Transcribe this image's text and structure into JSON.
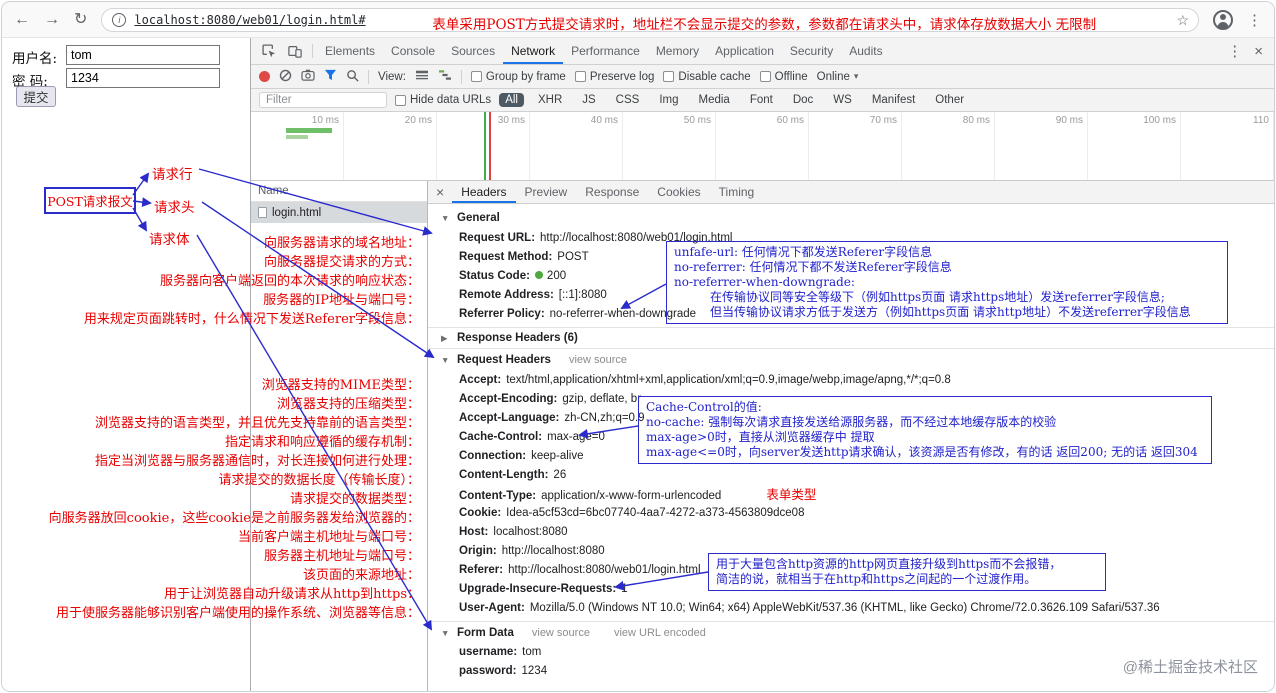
{
  "browser": {
    "url": "localhost:8080/web01/login.html#",
    "address_note": "表单采用POST方式提交请求时，地址栏不会显示提交的参数，参数都在请求头中，请求体存放数据大小 无限制",
    "icons": {
      "back": "←",
      "forward": "→",
      "reload": "↻",
      "info": "i",
      "star": "☆",
      "menu": "⋮"
    }
  },
  "page_form": {
    "username_label": "用户名:",
    "username_value": "tom",
    "password_label": "密 码:",
    "password_value": "1234",
    "submit_label": "提交"
  },
  "devtools": {
    "icons": {
      "more": "⋮",
      "close": "×",
      "caret": "▾",
      "tri_down": "▼",
      "tri_right": "▶"
    },
    "tabs": [
      "Elements",
      "Console",
      "Sources",
      "Network",
      "Performance",
      "Memory",
      "Application",
      "Security",
      "Audits"
    ],
    "toolbar": {
      "view_label": "View:",
      "group_by_frame": "Group by frame",
      "preserve_log": "Preserve log",
      "disable_cache": "Disable cache",
      "offline": "Offline",
      "online": "Online"
    },
    "filter_bar": {
      "filter_placeholder": "Filter",
      "hide_data_urls": "Hide data URLs",
      "types": [
        "All",
        "XHR",
        "JS",
        "CSS",
        "Img",
        "Media",
        "Font",
        "Doc",
        "WS",
        "Manifest",
        "Other"
      ]
    },
    "timeline_labels": [
      "10 ms",
      "20 ms",
      "30 ms",
      "40 ms",
      "50 ms",
      "60 ms",
      "70 ms",
      "80 ms",
      "90 ms",
      "100 ms",
      "110"
    ],
    "requests": {
      "name_header": "Name",
      "row_name": "login.html"
    },
    "detail_tabs": [
      "Headers",
      "Preview",
      "Response",
      "Cookies",
      "Timing"
    ],
    "general": {
      "title": "General",
      "items": [
        {
          "name": "Request URL:",
          "value": "http://localhost:8080/web01/login.html"
        },
        {
          "name": "Request Method:",
          "value": "POST"
        },
        {
          "name": "Status Code:",
          "value": "200"
        },
        {
          "name": "Remote Address:",
          "value": "[::1]:8080"
        },
        {
          "name": "Referrer Policy:",
          "value": "no-referrer-when-downgrade"
        }
      ]
    },
    "response_headers_title": "Response Headers (6)",
    "request_headers": {
      "title": "Request Headers",
      "view_source": "view source",
      "items": [
        {
          "name": "Accept:",
          "value": "text/html,application/xhtml+xml,application/xml;q=0.9,image/webp,image/apng,*/*;q=0.8"
        },
        {
          "name": "Accept-Encoding:",
          "value": "gzip, deflate, br"
        },
        {
          "name": "Accept-Language:",
          "value": "zh-CN,zh;q=0.9"
        },
        {
          "name": "Cache-Control:",
          "value": "max-age=0"
        },
        {
          "name": "Connection:",
          "value": "keep-alive"
        },
        {
          "name": "Content-Length:",
          "value": "26"
        },
        {
          "name": "Content-Type:",
          "value": "application/x-www-form-urlencoded"
        },
        {
          "name": "Cookie:",
          "value": "Idea-a5cf53cd=6bc07740-4aa7-4272-a373-4563809dce08"
        },
        {
          "name": "Host:",
          "value": "localhost:8080"
        },
        {
          "name": "Origin:",
          "value": "http://localhost:8080"
        },
        {
          "name": "Referer:",
          "value": "http://localhost:8080/web01/login.html"
        },
        {
          "name": "Upgrade-Insecure-Requests:",
          "value": "1"
        },
        {
          "name": "User-Agent:",
          "value": "Mozilla/5.0 (Windows NT 10.0; Win64; x64) AppleWebKit/537.36 (KHTML, like Gecko) Chrome/72.0.3626.109 Safari/537.36"
        }
      ]
    },
    "form_data": {
      "title": "Form Data",
      "view_source": "view source",
      "view_url_encoded": "view URL encoded",
      "items": [
        {
          "name": "username:",
          "value": "tom"
        },
        {
          "name": "password:",
          "value": "1234"
        }
      ]
    }
  },
  "annotations": {
    "post_box_label": "POST请求报文",
    "request_line_label": "请求行",
    "request_headers_label": "请求头",
    "request_body_label": "请求体",
    "content_type_note": "表单类型",
    "left_notes": [
      "向服务器请求的域名地址：",
      "向服务器提交请求的方式：",
      "服务器向客户端返回的本次请求的响应状态：",
      "服务器的IP地址与端口号：",
      "用来规定页面跳转时，什么情况下发送Referer字段信息：",
      "浏览器支持的MIME类型：",
      "浏览器支持的压缩类型：",
      "浏览器支持的语言类型，并且优先支持靠前的语言类型：",
      "指定请求和响应遵循的缓存机制：",
      "指定当浏览器与服务器通信时，对长连接如何进行处理：",
      "请求提交的数据长度（传输长度）：",
      "请求提交的数据类型：",
      "向服务器放回cookie，这些cookie是之前服务器发给浏览器的：",
      "当前客户端主机地址与端口号：",
      "服务器主机地址与端口号：",
      "该页面的来源地址：",
      "用于让浏览器自动升级请求从http到https：",
      "用于使服务器能够识别客户端使用的操作系统、浏览器等信息："
    ],
    "referrer_box_lines": [
      "unfafe-url: 任何情况下都发送Referer字段信息",
      "no-referrer: 任何情况下都不发送Referer字段信息",
      "no-referrer-when-downgrade:",
      "在传输协议同等安全等级下（例如https页面 请求https地址）发送referrer字段信息;",
      "但当传输协议请求方低于发送方（例如https页面 请求http地址）不发送referrer字段信息"
    ],
    "cache_box_lines": [
      "Cache-Control的值:",
      "no-cache: 强制每次请求直接发送给源服务器，而不经过本地缓存版本的校验",
      "max-age>0时，直接从浏览器缓存中 提取",
      "max-age<=0时，向server发送http请求确认，该资源是否有修改，有的话 返回200; 无的话 返回304"
    ],
    "upgrade_box_lines": [
      "用于大量包含http资源的http网页直接升级到https而不会报错，",
      "简洁的说，就相当于在http和https之间起的一个过渡作用。"
    ]
  },
  "watermark": "@稀土掘金技术社区"
}
